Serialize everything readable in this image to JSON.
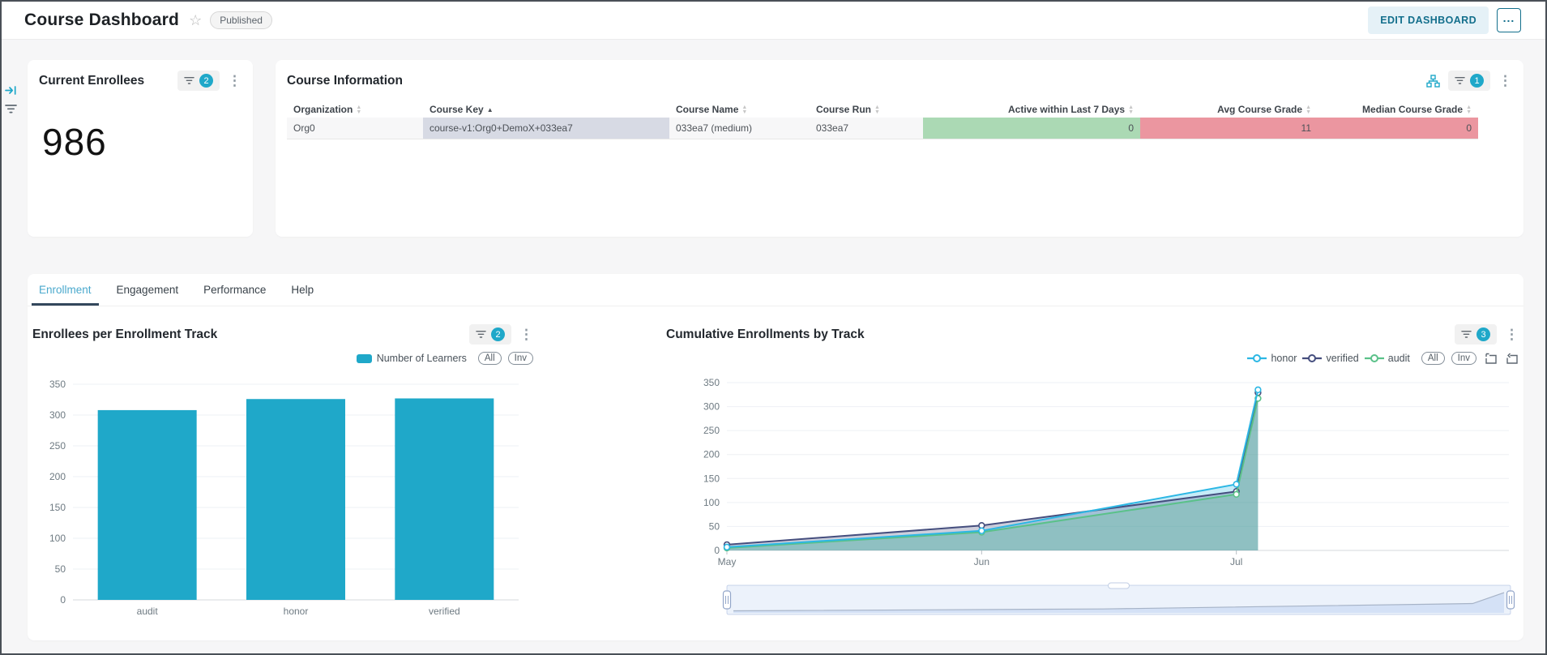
{
  "header": {
    "title": "Course Dashboard",
    "status_badge": "Published",
    "edit_button": "EDIT DASHBOARD",
    "more_button": "..."
  },
  "colors": {
    "accent": "#1fa8c9",
    "positive_cell": "#abd9b4",
    "negative_cell": "#eb96a0",
    "selected_cell": "#d7dae4",
    "row_bg": "#f7f7f8",
    "active_tab_text": "#4aa9cd",
    "active_tab_ink": "#33475c"
  },
  "icons": [
    "expand-filter-bar-icon",
    "filter-funnel-icon",
    "more-vert-kebab-icon",
    "cross-filter-tree-icon",
    "star-icon",
    "sort-carets-icon",
    "zoom-select-icon",
    "zoom-reset-icon"
  ],
  "current_enrollees": {
    "title": "Current Enrollees",
    "filter_count": "2",
    "value": "986"
  },
  "course_information": {
    "title": "Course Information",
    "filter_count": "1",
    "columns": [
      {
        "label": "Organization",
        "sort": "none",
        "align": "left"
      },
      {
        "label": "Course Key",
        "sort": "asc",
        "align": "left"
      },
      {
        "label": "Course Name",
        "sort": "none",
        "align": "left"
      },
      {
        "label": "Course Run",
        "sort": "none",
        "align": "left"
      },
      {
        "label": "Active within Last 7 Days",
        "sort": "none",
        "align": "right"
      },
      {
        "label": "Avg Course Grade",
        "sort": "none",
        "align": "right"
      },
      {
        "label": "Median Course Grade",
        "sort": "none",
        "align": "right"
      }
    ],
    "rows": [
      {
        "cells": [
          "Org0",
          "course-v1:Org0+DemoX+033ea7",
          "033ea7 (medium)",
          "033ea7",
          "0",
          "11",
          "0"
        ]
      }
    ]
  },
  "tabs": {
    "items": [
      {
        "label": "Enrollment",
        "active": true
      },
      {
        "label": "Engagement",
        "active": false
      },
      {
        "label": "Performance",
        "active": false
      },
      {
        "label": "Help",
        "active": false
      }
    ]
  },
  "bar_chart": {
    "filter_count": "2",
    "legend_label": "Number of Learners",
    "all_button": "All",
    "inv_button": "Inv"
  },
  "line_chart": {
    "filter_count": "3",
    "all_button": "All",
    "inv_button": "Inv"
  },
  "chart_data": [
    {
      "id": "enrollees-per-enrollment-track",
      "type": "bar",
      "title": "Enrollees per Enrollment Track",
      "categories": [
        "audit",
        "honor",
        "verified"
      ],
      "series": [
        {
          "name": "Number of Learners",
          "values": [
            308,
            326,
            327
          ]
        }
      ],
      "bar_color": "#1fa8c9",
      "ylim": [
        0,
        350
      ],
      "ytick_interval": 50,
      "grid": true,
      "legend_position": "top-right"
    },
    {
      "id": "cumulative-enrollments-by-track",
      "type": "area",
      "title": "Cumulative Enrollments by Track",
      "x": [
        "May",
        "Jun",
        "Jul",
        "early Jul (latest)"
      ],
      "x_numeric": [
        0,
        1,
        2,
        2.085
      ],
      "x_axis_ticks": [
        "May",
        "Jun",
        "Jul"
      ],
      "x_axis_range": [
        0,
        3.07
      ],
      "series": [
        {
          "name": "honor",
          "color": "#2cb7e4",
          "values": [
            7,
            41,
            138,
            335
          ]
        },
        {
          "name": "verified",
          "color": "#454e7e",
          "values": [
            12,
            52,
            123,
            329
          ]
        },
        {
          "name": "audit",
          "color": "#5ac189",
          "values": [
            5,
            38,
            117,
            317
          ]
        }
      ],
      "ylim": [
        0,
        350
      ],
      "ytick_interval": 50,
      "grid": true,
      "legend_position": "top-right",
      "has_range_slider": true
    }
  ]
}
